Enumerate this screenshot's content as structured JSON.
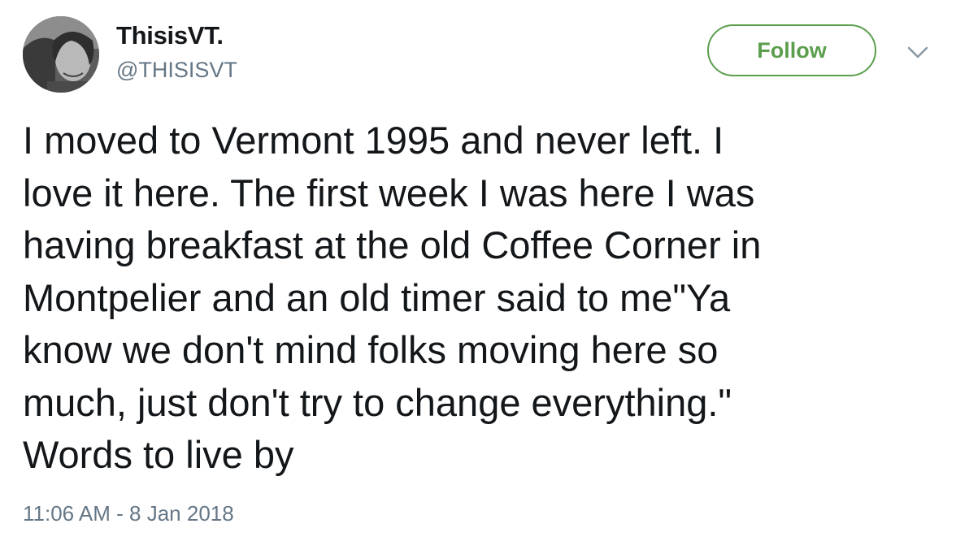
{
  "author": {
    "display_name": "ThisisVT.",
    "handle": "@THISISVT"
  },
  "follow_button": {
    "label": "Follow"
  },
  "menu": {
    "icon": "chevron-down-icon"
  },
  "tweet": {
    "text": "I moved to Vermont 1995 and never left. I\nlove it here. The first week I was here I was\nhaving breakfast at the old Coffee Corner in\nMontpelier and an old timer said to me\"Ya\nknow we don't mind folks moving here so\nmuch, just don't try to change everything.\"\nWords to live by",
    "timestamp": "11:06 AM - 8 Jan 2018"
  },
  "colors": {
    "follow_accent": "#5b9e4d",
    "secondary_text": "#657786",
    "primary_text": "#14171a"
  }
}
